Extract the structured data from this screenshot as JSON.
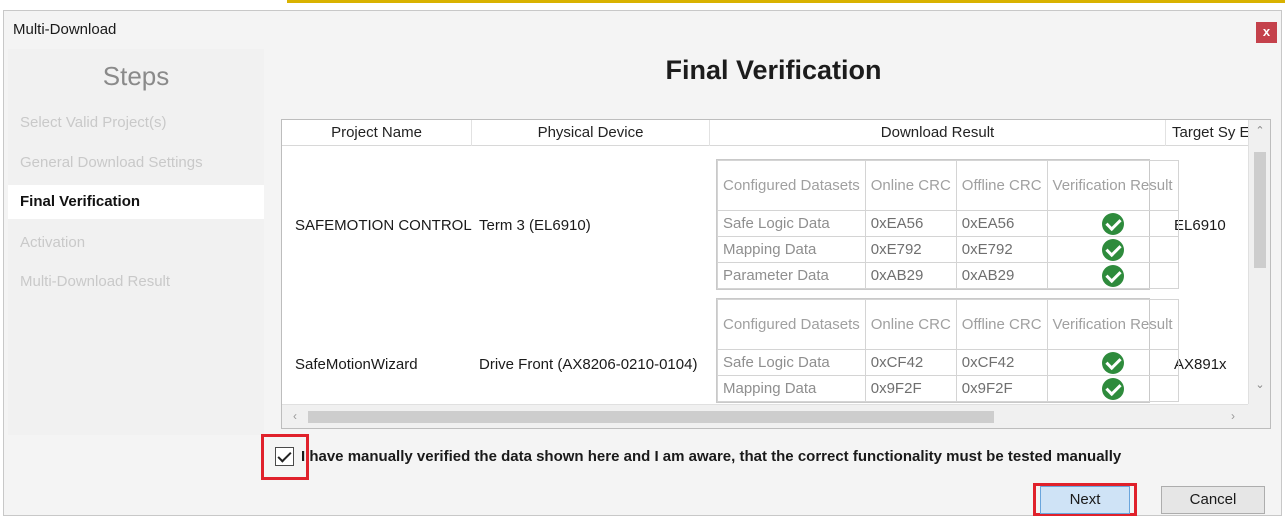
{
  "window": {
    "title": "Multi-Download",
    "close_label": "x"
  },
  "steps": {
    "title": "Steps",
    "items": [
      {
        "label": "Select Valid Project(s)"
      },
      {
        "label": "General Download Settings"
      },
      {
        "label": "Final Verification"
      },
      {
        "label": "Activation"
      },
      {
        "label": "Multi-Download Result"
      }
    ]
  },
  "main": {
    "heading": "Final Verification"
  },
  "grid": {
    "columns": [
      "Project Name",
      "Physical Device",
      "Download Result",
      "Target Sy E"
    ],
    "subheaders": {
      "configured": "Configured Datasets",
      "online": "Online CRC",
      "offline": "Offline CRC",
      "verification": "Verification Result"
    },
    "rows": [
      {
        "project": "SAFEMOTION CONTROL",
        "device": "Term 3 (EL6910)",
        "target": "EL6910",
        "datasets": [
          {
            "name": "Safe Logic Data",
            "online": "0xEA56",
            "offline": "0xEA56"
          },
          {
            "name": "Mapping Data",
            "online": "0xE792",
            "offline": "0xE792"
          },
          {
            "name": "Parameter Data",
            "online": "0xAB29",
            "offline": "0xAB29"
          }
        ]
      },
      {
        "project": "SafeMotionWizard",
        "device": "Drive Front (AX8206-0210-0104)",
        "target": "AX891x",
        "datasets": [
          {
            "name": "Safe Logic Data",
            "online": "0xCF42",
            "offline": "0xCF42"
          },
          {
            "name": "Mapping Data",
            "online": "0x9F2F",
            "offline": "0x9F2F"
          }
        ]
      }
    ]
  },
  "confirmation": {
    "checked": true,
    "text": "I have manually verified the data shown here and I am aware, that the correct functionality must be tested manually"
  },
  "buttons": {
    "next": "Next",
    "cancel": "Cancel"
  },
  "colors": {
    "highlight": "#e0212b",
    "verified": "#2e8b3c",
    "close": "#c4414b"
  }
}
